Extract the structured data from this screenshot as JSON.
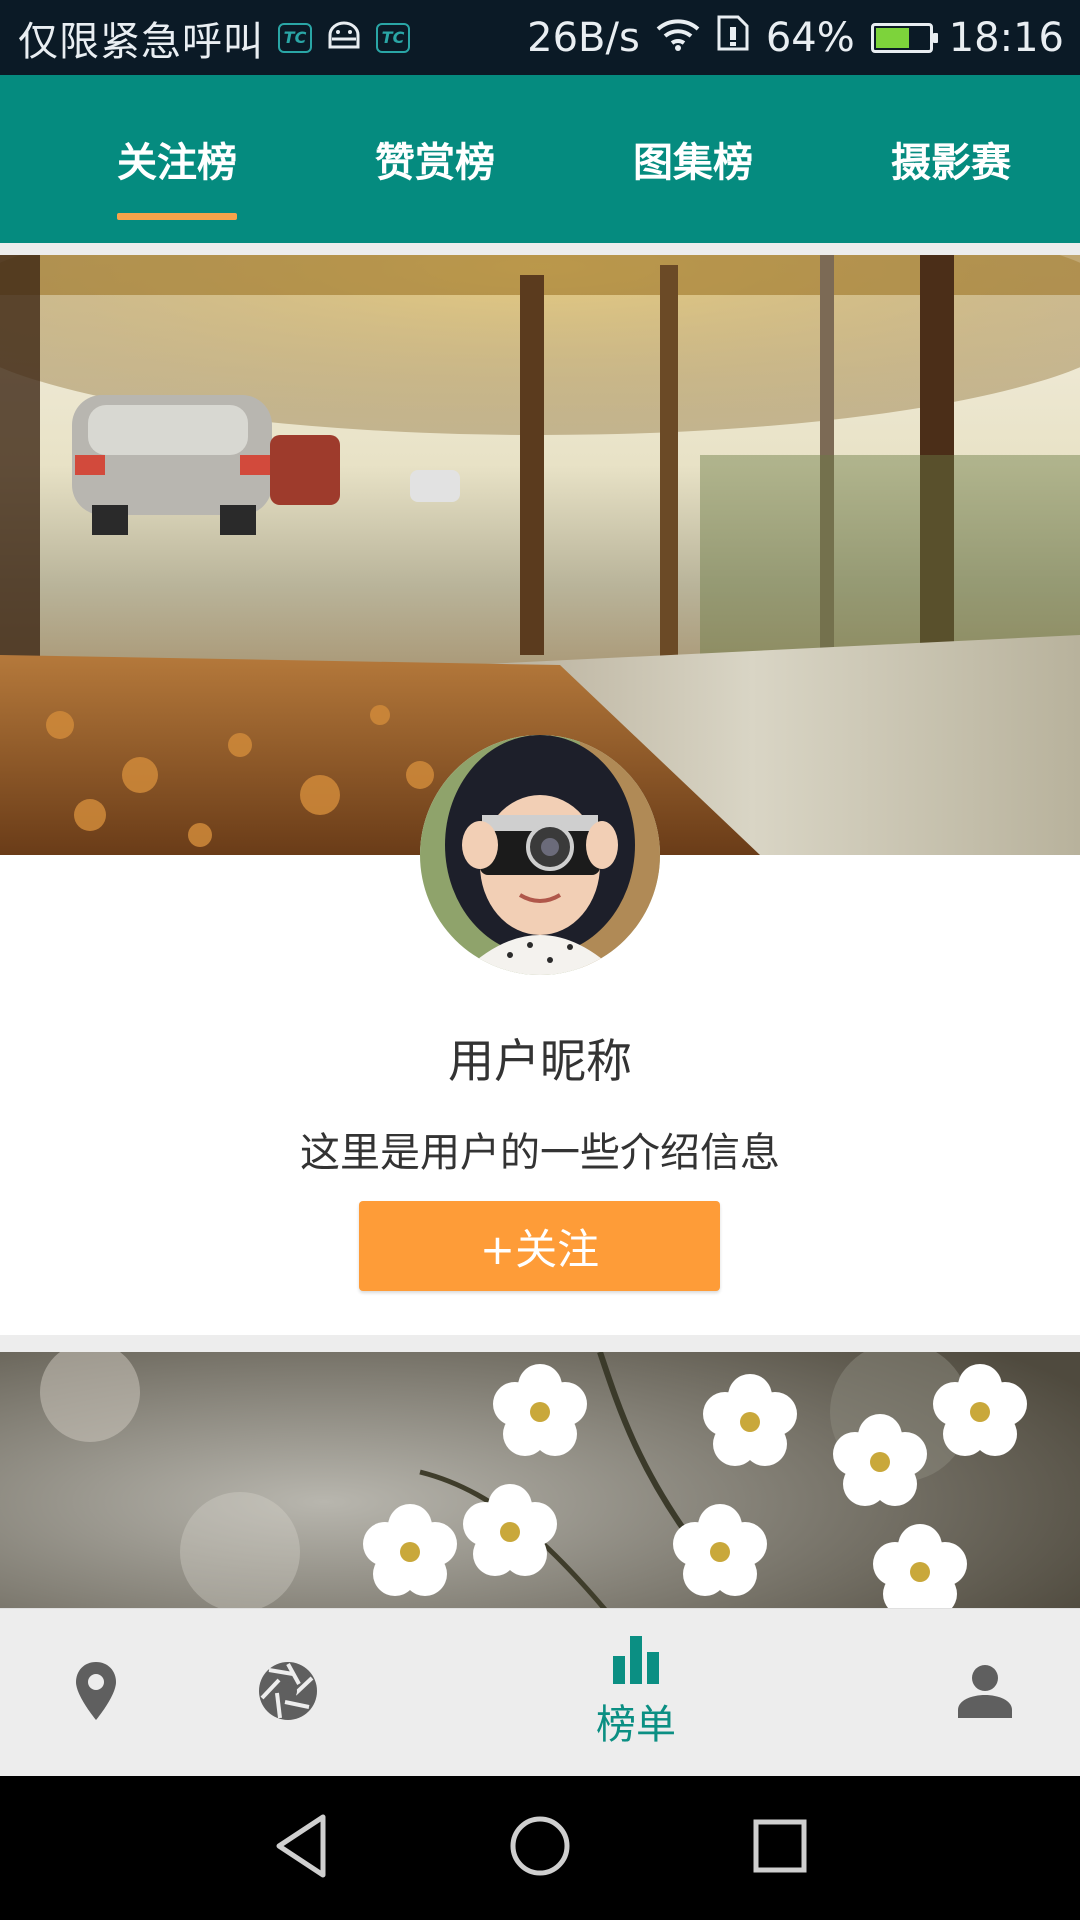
{
  "status_bar": {
    "carrier": "仅限紧急呼叫",
    "tc_label": "TC",
    "net_speed": "26B/s",
    "battery": "64%",
    "battery_level": 0.64,
    "time": "18:16"
  },
  "tabs": [
    {
      "label": "关注榜",
      "selected": true
    },
    {
      "label": "赞赏榜",
      "selected": false
    },
    {
      "label": "图集榜",
      "selected": false
    },
    {
      "label": "摄影赛",
      "selected": false
    }
  ],
  "colors": {
    "primary": "#058b7f",
    "tab_indicator": "#f7a34a",
    "follow_button": "#fe9c38",
    "nav_active": "#0b8f83",
    "nav_inactive": "#5f5f5f"
  },
  "cards": [
    {
      "username": "用户昵称",
      "description": "这里是用户的一些介绍信息",
      "follow_label": "+关注"
    }
  ],
  "bottom_nav": {
    "items": [
      {
        "icon": "location-pin-icon",
        "label": ""
      },
      {
        "icon": "camera-aperture-icon",
        "label": ""
      },
      {
        "icon": "bar-chart-icon",
        "label": "榜单",
        "active": true
      },
      {
        "icon": "person-icon",
        "label": ""
      }
    ]
  },
  "system_nav": [
    "back-icon",
    "home-icon",
    "recents-icon"
  ]
}
